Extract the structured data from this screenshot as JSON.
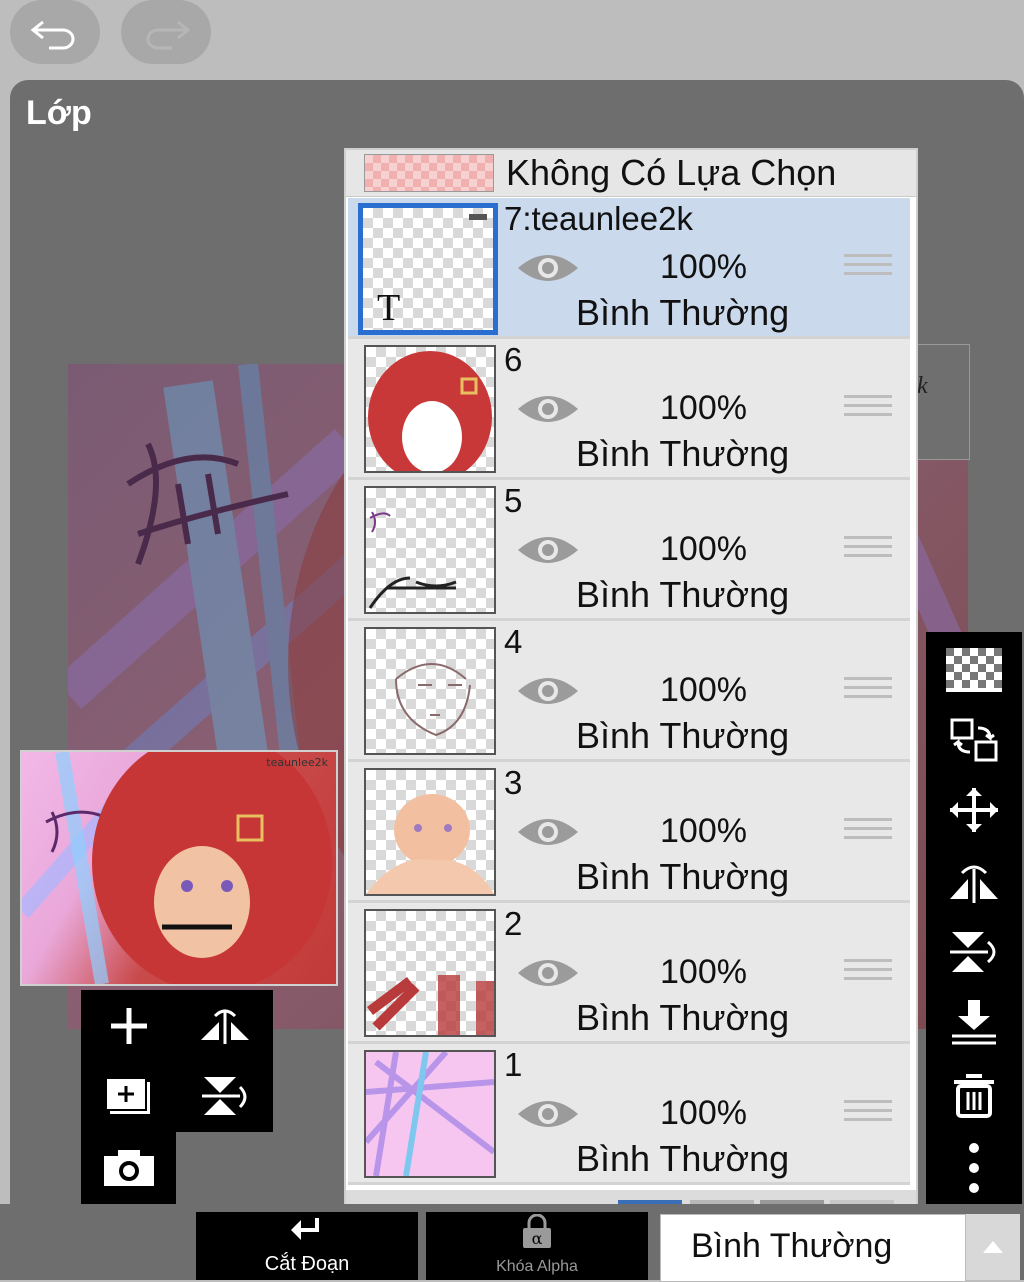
{
  "panel": {
    "title": "Lớp"
  },
  "topbar": {
    "undo_icon": "undo-icon",
    "redo_icon": "redo-icon"
  },
  "canvas": {
    "watermark_fragment": "2k"
  },
  "thumbnail": {
    "tag": "teaunlee2k"
  },
  "selection_row": {
    "label": "Không Có Lựa Chọn"
  },
  "layers": [
    {
      "name": "7:teaunlee2k",
      "opacity": "100%",
      "blend": "Bình Thường",
      "active": true,
      "text_layer_glyph": "T"
    },
    {
      "name": "6",
      "opacity": "100%",
      "blend": "Bình Thường"
    },
    {
      "name": "5",
      "opacity": "100%",
      "blend": "Bình Thường"
    },
    {
      "name": "4",
      "opacity": "100%",
      "blend": "Bình Thường"
    },
    {
      "name": "3",
      "opacity": "100%",
      "blend": "Bình Thường"
    },
    {
      "name": "2",
      "opacity": "100%",
      "blend": "Bình Thường"
    },
    {
      "name": "1",
      "opacity": "100%",
      "blend": "Bình Thường"
    }
  ],
  "bottom": {
    "clip_label": "Cắt Đoạn",
    "alpha_lock_label": "Khóa Alpha",
    "blend_mode": "Bình Thường"
  },
  "colors": {
    "panel": "#6e6e6e",
    "active_layer": "#cbd9ec",
    "active_border": "#2a6fd0",
    "toolbar": "#000000"
  }
}
